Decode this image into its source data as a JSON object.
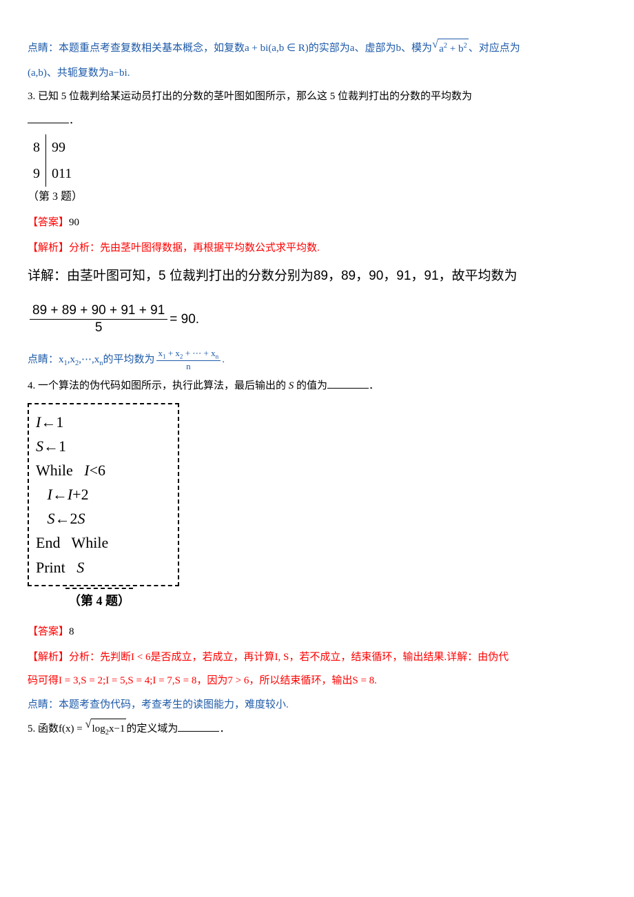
{
  "para1": {
    "prefix": "点睛：本题重点考查复数相关基本概念，如复数",
    "expr1": "a + bi(a,b ∈ R)",
    "mid1": "的实部为",
    "a": "a",
    "mid2": "、虚部为",
    "b": "b",
    "mid3": "、模为",
    "sqrt_body": "a",
    "sqrt_sup": "2",
    "sqrt_plus": " + b",
    "sqrt_sup2": "2",
    "mid4": "、对应点为"
  },
  "para1b": {
    "pt": "(a,b)",
    "mid": "、共轭复数为",
    "conj": "a−bi."
  },
  "q3": {
    "text": "3.  已知 5 位裁判给某运动员打出的分数的茎叶图如图所示，那么这 5 位裁判打出的分数的平均数为",
    "period": "．"
  },
  "stemleaf": {
    "r1s": "8",
    "r1l": "99",
    "r2s": "9",
    "r2l": "011",
    "label": "（第 3 题）"
  },
  "ans3": {
    "label": "【答案】",
    "val": "90"
  },
  "ana3": {
    "label": "【解析】",
    "text": "分析：先由茎叶图得数据，再根据平均数公式求平均数."
  },
  "detail3": {
    "prefix": "详解：由茎叶图可知，5 位裁判打出的分数分别为",
    "nums": "89，89，90，91，91",
    "suffix": "，故平均数为"
  },
  "frac3": {
    "num": "89 + 89 + 90 + 91 + 91",
    "den": "5",
    "eq": " = 90."
  },
  "tip3": {
    "prefix": "点睛：",
    "body1": "x",
    "sub1": "1",
    "c1": ",x",
    "sub2": "2",
    "c2": ",⋯,x",
    "subn": "n",
    "mid": "的平均数为",
    "fnum1": "x",
    "fnums1": "1",
    "fplus1": " + x",
    "fnums2": "2",
    "fplus2": " + ⋯ + x",
    "fnumsn": "n",
    "fden": "n",
    "end": "."
  },
  "q4": {
    "text": "4.  一个算法的伪代码如图所示，执行此算法，最后输出的 ",
    "S": "S",
    "text2": " 的值为",
    "period": "．"
  },
  "code": {
    "l1a": "I",
    "l1b": "←1",
    "l2a": "S",
    "l2b": "←1",
    "l3a": "While   ",
    "l3b": "I",
    "l3c": "<6",
    "l4a": "   I",
    "l4b": "←",
    "l4c": "I",
    "l4d": "+2",
    "l5a": "   S",
    "l5b": "←2",
    "l5c": "S",
    "l6": "End   While",
    "l7a": "Print   ",
    "l7b": "S",
    "label": "（第 4 题）"
  },
  "ans4": {
    "label": "【答案】",
    "val": "8"
  },
  "ana4": {
    "label": "【解析】",
    "text1": "分析：先判断",
    "cond": "I < 6",
    "text2": "是否成立，若成立，再计算",
    "IS": "I, S",
    "text3": "，若不成立，结束循环，输出结果.详解：由伪代"
  },
  "ana4b": {
    "text1": "码可得",
    "vals": "I = 3,S = 2;I = 5,S = 4;I = 7,S = 8",
    "text2": "，因为",
    "cmp": "7 > 6",
    "text3": "，所以结束循环，输出",
    "out": "S = 8."
  },
  "tip4": {
    "text": "点睛：本题考查伪代码，考查考生的读图能力，难度较小."
  },
  "q5": {
    "text": "5.  函数",
    "fn": "f(x) = ",
    "sqrt_body1": "log",
    "sqrt_sub": "2",
    "sqrt_body2": "x−1",
    "text2": "的定义域为",
    "period": "．"
  }
}
